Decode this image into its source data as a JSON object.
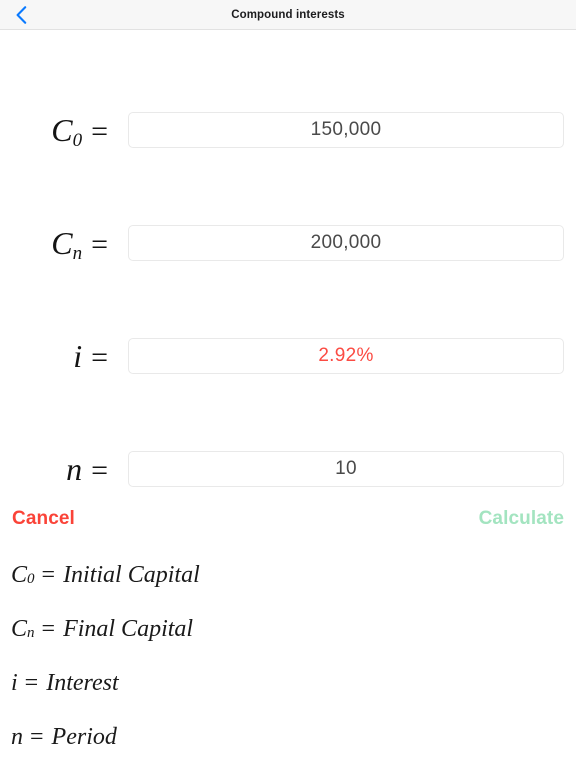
{
  "header": {
    "title": "Compound interests",
    "back_icon": "chevron-left-icon",
    "back_color": "#0a7aff",
    "background": "#f7f7f7"
  },
  "form": {
    "rows": [
      {
        "symbol": "C",
        "subscript": "0",
        "equals": "=",
        "value": "150,000",
        "is_result": false,
        "name": "initial-capital"
      },
      {
        "symbol": "C",
        "subscript": "n",
        "equals": "=",
        "value": "200,000",
        "is_result": false,
        "name": "final-capital"
      },
      {
        "symbol": "i",
        "subscript": "",
        "equals": "=",
        "value": "2.92%",
        "is_result": true,
        "name": "interest"
      },
      {
        "symbol": "n",
        "subscript": "",
        "equals": "=",
        "value": "10",
        "is_result": false,
        "name": "period"
      }
    ]
  },
  "actions": {
    "cancel_label": "Cancel",
    "cancel_color": "#fa4338",
    "calculate_label": "Calculate",
    "calculate_color": "#a3e4c0"
  },
  "legend": {
    "lines": [
      {
        "symbol": "C",
        "subscript": "0",
        "equals": "=",
        "term": "Initial Capital"
      },
      {
        "symbol": "C",
        "subscript": "n",
        "equals": "=",
        "term": "Final Capital"
      },
      {
        "symbol": "i",
        "subscript": "",
        "equals": "=",
        "term": "Interest"
      },
      {
        "symbol": "n",
        "subscript": "",
        "equals": "=",
        "term": "Period"
      }
    ]
  },
  "result_color": "#fb4b43",
  "value_color": "#4a4a4a"
}
